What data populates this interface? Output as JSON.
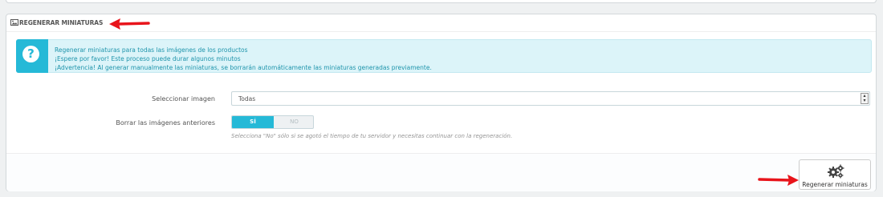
{
  "panel": {
    "title": "REGENERAR MINIATURAS",
    "icon": "image-icon"
  },
  "alert": {
    "icon": "question-circle-icon",
    "icon_glyph": "?",
    "lines": [
      "Regenerar miniaturas para todas las imágenes de los productos",
      "¡Espere por favor! Este proceso puede durar algunos minutos",
      "¡Advertencia! Al generar manualmente las miniaturas, se borrarán automáticamente las miniaturas generadas previamente."
    ]
  },
  "form": {
    "select_image_label": "Seleccionar imagen",
    "select_image_value": "Todas",
    "erase_label": "Borrar las imágenes anteriores",
    "toggle_yes": "SÍ",
    "toggle_no": "NO",
    "toggle_selected": "SÍ",
    "help": "Selecciona \"No\" sólo si se agotó el tiempo de tu servidor y necesitas continuar con la regeneración."
  },
  "footer": {
    "button_label": "Regenerar miniaturas",
    "button_icon": "gears-icon"
  },
  "colors": {
    "accent": "#25b9d7",
    "annotation_arrow": "#e8141b"
  }
}
